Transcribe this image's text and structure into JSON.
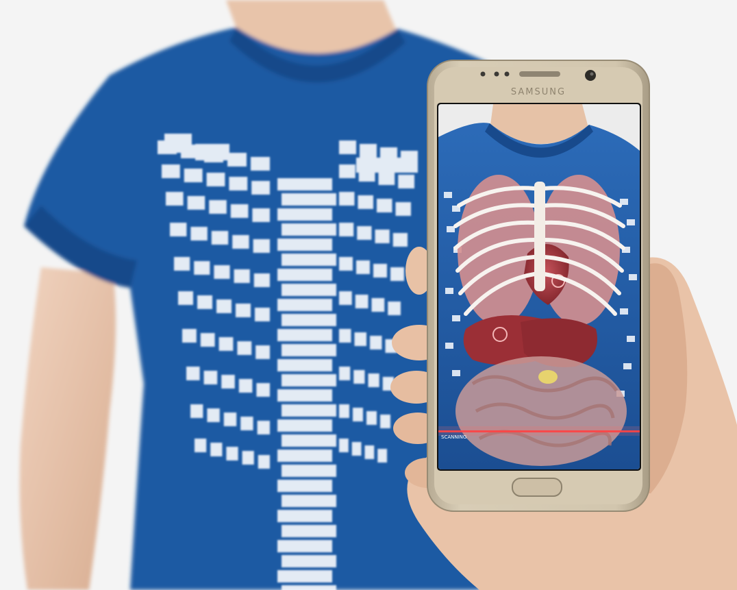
{
  "phone": {
    "brand": "SAMSUNG",
    "screen_status": "SCANNING"
  },
  "colors": {
    "background": "#f4f4f4",
    "skin": "#e8c7ae",
    "skin_shadow": "#d4a98c",
    "shirt_blue": "#1f5aa3",
    "shirt_dark": "#174a8a",
    "print_white": "#f3f6fb",
    "phone_gold": "#cbbfa8",
    "phone_gold_dark": "#a99d86",
    "organ_red": "#a3333b",
    "organ_pink": "#d98a8a",
    "intestine": "#c89a9a",
    "scan_line": "#ff3b3b"
  },
  "icons": [
    "front-camera-icon",
    "earpiece-speaker-icon",
    "home-button-icon",
    "ar-marker-icon"
  ]
}
